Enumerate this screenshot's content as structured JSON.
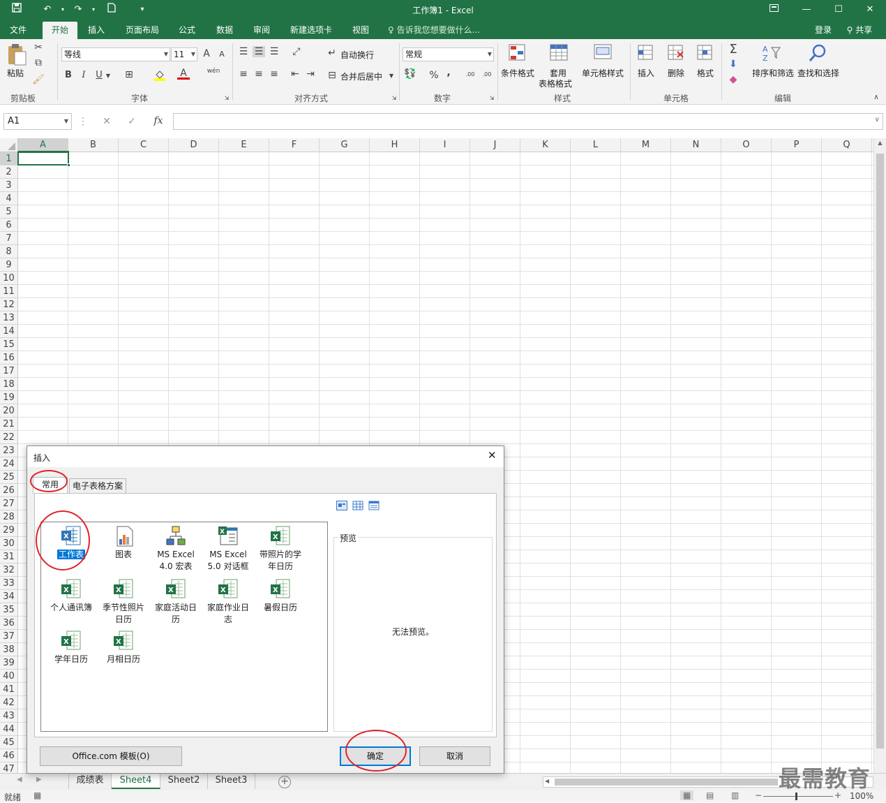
{
  "window": {
    "title": "工作簿1 - Excel"
  },
  "ribbon_tabs": [
    "文件",
    "开始",
    "插入",
    "页面布局",
    "公式",
    "数据",
    "审阅",
    "新建选项卡",
    "视图"
  ],
  "tell_me": "告诉我您想要做什么...",
  "account": {
    "signin": "登录",
    "share": "共享"
  },
  "clipboard": {
    "paste": "粘贴",
    "group": "剪贴板"
  },
  "font": {
    "name": "等线",
    "size": "11",
    "group": "字体",
    "grow": "A",
    "shrink": "A",
    "bold": "B",
    "italic": "I",
    "underline": "U",
    "color_a": "A",
    "phonetic": "wén"
  },
  "alignment": {
    "wrap": "自动换行",
    "merge": "合并后居中",
    "group": "对齐方式"
  },
  "number": {
    "format": "常规",
    "percent": "%",
    "comma": ",",
    "inc": ".00",
    "dec": ".00",
    "group": "数字"
  },
  "styles": {
    "conditional": "条件格式",
    "table_line1": "套用",
    "table_line2": "表格格式",
    "cell": "单元格样式",
    "group": "样式"
  },
  "cells": {
    "insert": "插入",
    "delete": "删除",
    "format": "格式",
    "group": "单元格"
  },
  "editing": {
    "sort": "排序和筛选",
    "find": "查找和选择",
    "group": "编辑",
    "sigma": "Σ"
  },
  "formula_bar": {
    "name_box": "A1",
    "fx": "fx",
    "cancel": "✕",
    "enter": "✓",
    "value": ""
  },
  "columns": [
    "A",
    "B",
    "C",
    "D",
    "E",
    "F",
    "G",
    "H",
    "I",
    "J",
    "K",
    "L",
    "M",
    "N",
    "O",
    "P",
    "Q"
  ],
  "rows": [
    "1",
    "2",
    "3",
    "4",
    "5",
    "6",
    "7",
    "8",
    "9",
    "10",
    "11",
    "12",
    "13",
    "14",
    "15",
    "16",
    "17",
    "18",
    "19",
    "20",
    "21",
    "22",
    "23",
    "24",
    "25",
    "26",
    "27",
    "28",
    "29",
    "30",
    "31",
    "32",
    "33",
    "34",
    "35",
    "36",
    "37",
    "38",
    "39",
    "40",
    "41",
    "42",
    "43",
    "44",
    "45",
    "46",
    "47"
  ],
  "sheets": [
    "成绩表",
    "Sheet4",
    "Sheet2",
    "Sheet3"
  ],
  "active_sheet": "Sheet4",
  "status": {
    "ready": "就绪",
    "zoom": "100%",
    "minus": "−",
    "plus": "+"
  },
  "dialog": {
    "title": "插入",
    "close": "✕",
    "tabs": [
      "常用",
      "电子表格方案"
    ],
    "items": [
      {
        "line1": "工作表",
        "line2": "",
        "icon": "worksheet-icon"
      },
      {
        "line1": "图表",
        "line2": "",
        "icon": "chart-icon"
      },
      {
        "line1": "MS Excel",
        "line2": "4.0 宏表",
        "icon": "macro-sheet-icon"
      },
      {
        "line1": "MS Excel",
        "line2": "5.0 对话框",
        "icon": "dialog-sheet-icon"
      },
      {
        "line1": "带照片的学",
        "line2": "年日历",
        "icon": "excel-template-icon"
      },
      {
        "line1": "个人通讯簿",
        "line2": "",
        "icon": "excel-template-icon"
      },
      {
        "line1": "季节性照片",
        "line2": "日历",
        "icon": "excel-template-icon"
      },
      {
        "line1": "家庭活动日",
        "line2": "历",
        "icon": "excel-template-icon"
      },
      {
        "line1": "家庭作业日",
        "line2": "志",
        "icon": "excel-template-icon"
      },
      {
        "line1": "暑假日历",
        "line2": "",
        "icon": "excel-template-icon"
      },
      {
        "line1": "学年日历",
        "line2": "",
        "icon": "excel-template-icon"
      },
      {
        "line1": "月相日历",
        "line2": "",
        "icon": "excel-template-icon"
      }
    ],
    "preview_label": "预览",
    "preview_text": "无法预览。",
    "buttons": {
      "templates": "Office.com 模板(O)",
      "ok": "确定",
      "cancel": "取消"
    }
  },
  "watermark": "最需教育"
}
